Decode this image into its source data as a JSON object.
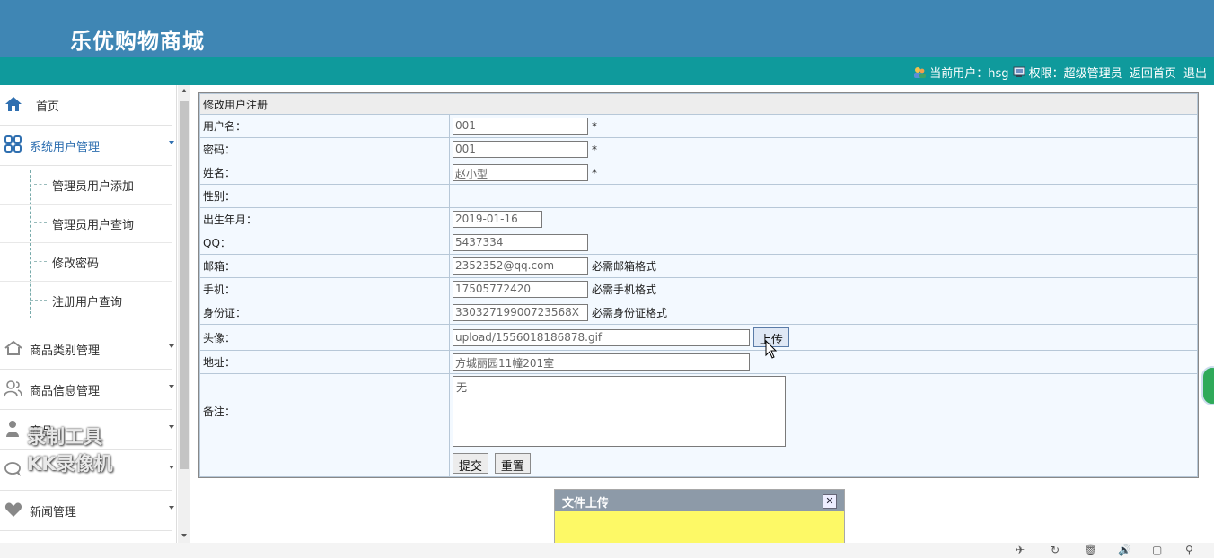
{
  "header": {
    "title": "乐优购物商城"
  },
  "userbar": {
    "current_user_label": "当前用户：hsg",
    "role_label": "权限：超级管理员",
    "home_link": "返回首页",
    "logout_link": "退出"
  },
  "sidebar": {
    "home": "首页",
    "sys_user_mgmt": "系统用户管理",
    "sub": [
      "管理员用户添加",
      "管理员用户查询",
      "修改密码",
      "注册用户查询"
    ],
    "category_mgmt": "商品类别管理",
    "product_mgmt": "商品信息管理",
    "item3": "商品",
    "item4": "",
    "news_mgmt": "新闻管理"
  },
  "form": {
    "title": "修改用户注册",
    "username_label": "用户名：",
    "username_value": "001",
    "password_label": "密码：",
    "password_value": "001",
    "name_label": "姓名：",
    "name_value": "赵小型",
    "gender_label": "性别：",
    "birth_label": "出生年月：",
    "birth_value": "2019-01-16",
    "qq_label": "QQ：",
    "qq_value": "5437334",
    "email_label": "邮箱：",
    "email_value": "2352352@qq.com",
    "email_hint": "必需邮箱格式",
    "phone_label": "手机：",
    "phone_value": "17505772420",
    "phone_hint": "必需手机格式",
    "id_label": "身份证：",
    "id_value": "33032719900723568X",
    "id_hint": "必需身份证格式",
    "avatar_label": "头像：",
    "avatar_value": "upload/1556018186878.gif",
    "upload_button": "上传",
    "address_label": "地址：",
    "address_value": "方城丽园11幢201室",
    "remark_label": "备注：",
    "remark_value": "无",
    "required_mark": "*",
    "submit_button": "提交",
    "reset_button": "重置"
  },
  "dialog": {
    "title": "文件上传",
    "close": "✕"
  },
  "watermark": {
    "line1": "录制工具",
    "line2": "KK录像机"
  }
}
